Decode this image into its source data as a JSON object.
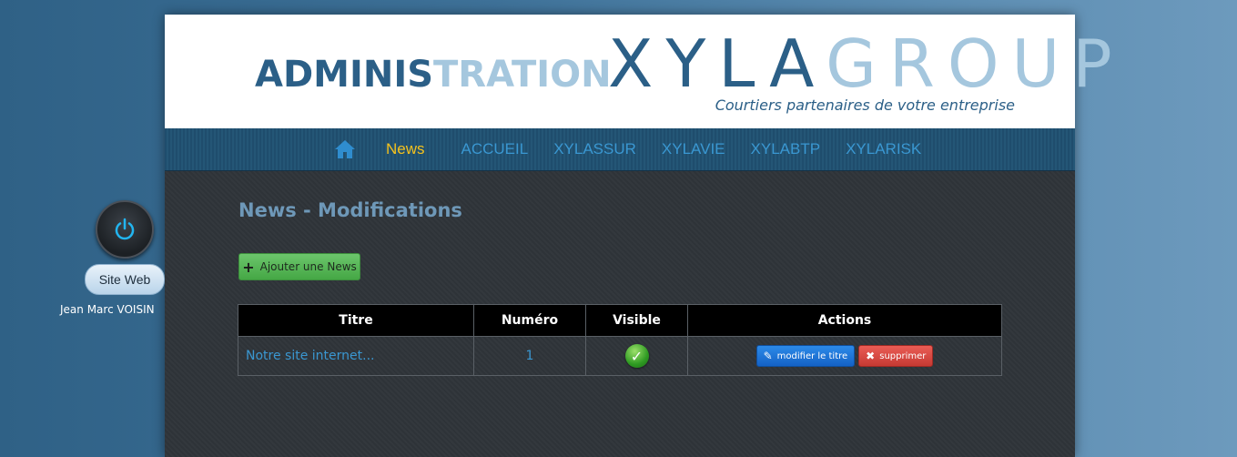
{
  "header": {
    "admin_part1": "ADMINIS",
    "admin_part2": "TRATION",
    "brand_part1": "XYLA",
    "brand_part2": "GROUP",
    "tagline": "Courtiers partenaires de votre entreprise"
  },
  "nav": {
    "home_icon": "home-icon",
    "items": [
      {
        "label": "News",
        "active": true
      },
      {
        "label": "ACCUEIL"
      },
      {
        "label": "XYLASSUR"
      },
      {
        "label": "XYLAVIE"
      },
      {
        "label": "XYLABTP"
      },
      {
        "label": "XYLARISK"
      }
    ]
  },
  "sidebar": {
    "power_icon": "power-icon",
    "site_web_label": "Site Web",
    "user_name": "Jean Marc VOISIN"
  },
  "main": {
    "title": "News - Modifications",
    "add_button_label": "Ajouter une News",
    "table": {
      "headers": [
        "Titre",
        "Numéro",
        "Visible",
        "Actions"
      ],
      "rows": [
        {
          "titre": "Notre site internet...",
          "numero": "1",
          "visible": true,
          "edit_label": "modifier le titre",
          "delete_label": "supprimer"
        }
      ]
    }
  },
  "colors": {
    "accent_blue": "#3a97d1",
    "active_nav": "#f5c21d",
    "title_blue": "#6e98b8",
    "brand_dark": "#2b5f87",
    "brand_light": "#a5c7de"
  }
}
